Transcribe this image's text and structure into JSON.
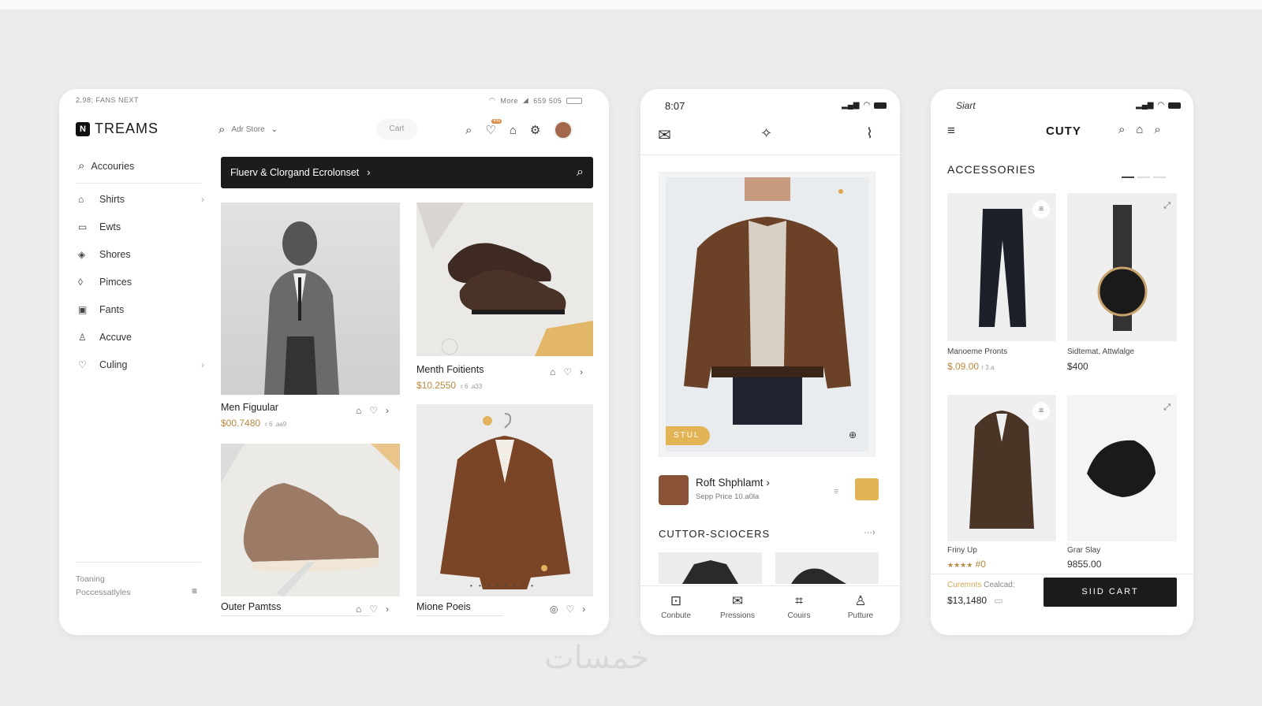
{
  "tablet": {
    "status_left": "2.98; FANS NEXT",
    "status_right": "More",
    "status_nums": "659 505",
    "brand_badge": "N",
    "brand": "TREAMS",
    "search_placeholder": "Adr Store",
    "cart_chip": "Cart",
    "notif_badge": "4%",
    "sidebar_search": "Accouries",
    "nav": [
      {
        "label": "Shirts",
        "icon": "shirt-icon",
        "glyph": "⌂",
        "chev": true
      },
      {
        "label": "Ewts",
        "icon": "card-icon",
        "glyph": "▭",
        "chev": false
      },
      {
        "label": "Shores",
        "icon": "shield-icon",
        "glyph": "◈",
        "chev": false
      },
      {
        "label": "Pimces",
        "icon": "tag-icon",
        "glyph": "◊",
        "chev": false
      },
      {
        "label": "Fants",
        "icon": "wallet-icon",
        "glyph": "▣",
        "chev": false
      },
      {
        "label": "Accuve",
        "icon": "user-icon",
        "glyph": "♙",
        "chev": false
      },
      {
        "label": "Culing",
        "icon": "heart-icon",
        "glyph": "♡",
        "chev": true
      }
    ],
    "footer_line1": "Toaning",
    "footer_line2": "Poccessatlyles",
    "banner": "Fluerv & Clorgand Ecrolonset",
    "products": [
      {
        "name": "Men Figuular",
        "price": "$00.7480",
        "sub": "r 6 .aa9"
      },
      {
        "name": "Menth Foitients",
        "price": "$10.2550",
        "sub": "r 6 .a33"
      },
      {
        "name": "Outer Pamtss",
        "price": "",
        "sub": ""
      },
      {
        "name": "Mione Poeis",
        "price": "",
        "sub": ""
      }
    ]
  },
  "phone": {
    "time": "8:07",
    "stock_tag": "STUL",
    "item_name": "Roft Shphlamt",
    "item_sub": "Sepp Price 10.a0la",
    "section": "CUTTOR-SCIOCERS",
    "tabs": [
      {
        "label": "Conbute",
        "icon": "cart-icon",
        "glyph": "⊡"
      },
      {
        "label": "Pressions",
        "icon": "mail-icon",
        "glyph": "✉"
      },
      {
        "label": "Couirs",
        "icon": "tag-icon",
        "glyph": "⌗"
      },
      {
        "label": "Putture",
        "icon": "user-icon",
        "glyph": "♙"
      }
    ]
  },
  "phone2": {
    "time": "Siart",
    "brand": "CUTY",
    "section": "ACCESSORIES",
    "products": [
      {
        "name": "Manoeme Pronts",
        "price": "$.09.00",
        "sub": "r 3.a"
      },
      {
        "name": "Sidtemat, Attwlalge",
        "price": "$400",
        "sub": ""
      },
      {
        "name": "Friny Up",
        "price": "#0",
        "sub": "★★★★"
      },
      {
        "name": "Grar Slay",
        "price": "9855.00",
        "sub": ""
      }
    ],
    "footer_label_a": "Curemnts",
    "footer_label_b": "Cealcad:",
    "footer_total": "$13,1480",
    "cta": "SIID CART"
  },
  "watermark": "خمسات",
  "colors": {
    "accent": "#d4a853",
    "dark": "#1c1c1c",
    "bg": "#ececec"
  }
}
